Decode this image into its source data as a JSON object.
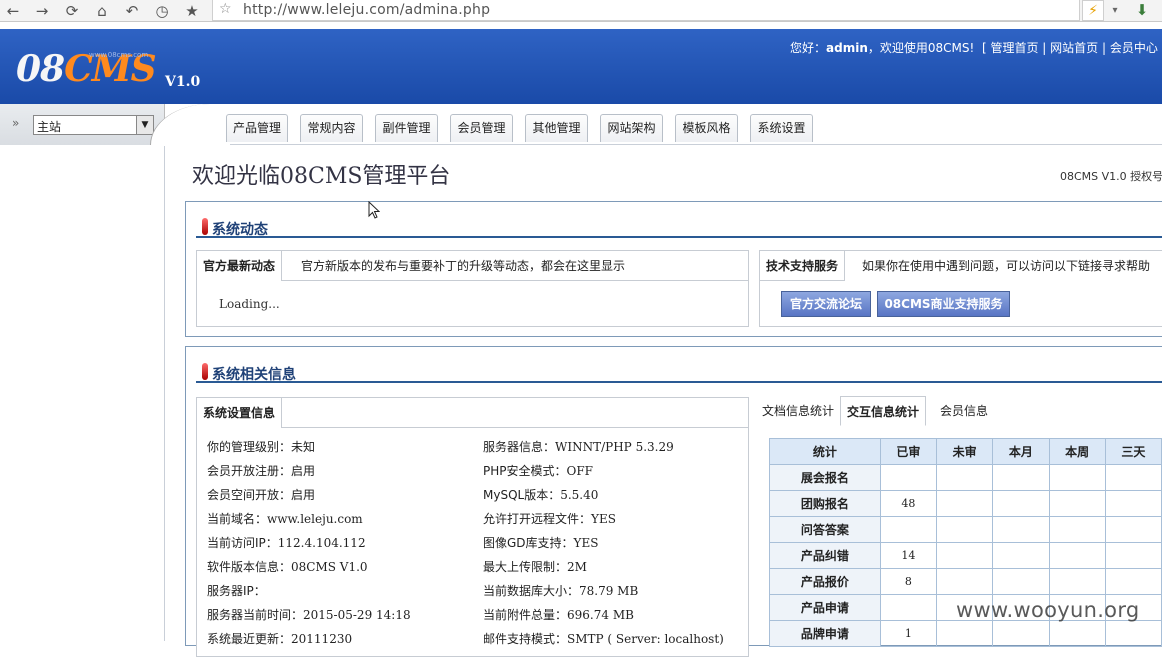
{
  "browser": {
    "url": "http://www.leleju.com/admina.php",
    "back_icon": "←",
    "forward_icon": "→",
    "reload_icon": "⟳",
    "home_icon": "⌂",
    "undo_icon": "↶",
    "history_icon": "◷",
    "bookmark_icon": "★",
    "star_icon": "☆",
    "bolt_icon": "⚡",
    "caret_icon": "▾",
    "ext_icon": "⬇"
  },
  "header": {
    "logo_a": "08",
    "logo_b": "CMS",
    "logo_tag": "www.08cms.com",
    "version": "V1.0",
    "greet_prefix": "您好：",
    "user": "admin",
    "greet_suffix": "，欢迎使用08CMS!",
    "links": "[ 管理首页 | 网站首页 | 会员中心 | 锁"
  },
  "nav": {
    "dbl_icon": "»",
    "site_select": "主站",
    "select_arrow": "▼",
    "tabs": [
      "产品管理",
      "常规内容",
      "副件管理",
      "会员管理",
      "其他管理",
      "网站架构",
      "模板风格",
      "系统设置"
    ]
  },
  "page": {
    "title": "欢迎光临08CMS管理平台",
    "license": "08CMS V1.0 授权号"
  },
  "dynamics": {
    "title": "系统动态",
    "news_tab": "官方最新动态",
    "news_desc": "官方新版本的发布与重要补丁的升级等动态，都会在这里显示",
    "loading": "Loading...",
    "support_tab": "技术支持服务",
    "support_desc": "如果你在使用中遇到问题，可以访问以下链接寻求帮助",
    "btn_forum": "官方交流论坛",
    "btn_service": "08CMS商业支持服务"
  },
  "sysinfo": {
    "title": "系统相关信息",
    "tab": "系统设置信息",
    "left": [
      {
        "k": "你的管理级别：",
        "v": "未知"
      },
      {
        "k": "会员开放注册：",
        "v": "启用"
      },
      {
        "k": "会员空间开放：",
        "v": "启用"
      },
      {
        "k": "当前域名：",
        "v": "www.leleju.com"
      },
      {
        "k": "当前访问IP：",
        "v": "112.4.104.112"
      },
      {
        "k": "软件版本信息：",
        "v": "08CMS V1.0"
      },
      {
        "k": "服务器IP：",
        "v": ""
      },
      {
        "k": "服务器当前时间：",
        "v": "2015-05-29 14:18"
      },
      {
        "k": "系统最近更新：",
        "v": "20111230"
      }
    ],
    "right": [
      {
        "k": "服务器信息：",
        "v": "WINNT/PHP 5.3.29"
      },
      {
        "k": "PHP安全模式：",
        "v": "OFF"
      },
      {
        "k": "MySQL版本：",
        "v": "5.5.40"
      },
      {
        "k": "允许打开远程文件：",
        "v": "YES"
      },
      {
        "k": "图像GD库支持：",
        "v": "YES"
      },
      {
        "k": "最大上传限制：",
        "v": "2M"
      },
      {
        "k": "当前数据库大小：",
        "v": "78.79 MB"
      },
      {
        "k": "当前附件总量：",
        "v": "696.74 MB"
      },
      {
        "k": "邮件支持模式：",
        "v": "SMTP ( Server: localhost)"
      }
    ]
  },
  "stats": {
    "tabs": [
      "文档信息统计",
      "交互信息统计",
      "会员信息"
    ],
    "headers": [
      "统计",
      "已审",
      "未审",
      "本月",
      "本周",
      "三天"
    ],
    "rows": [
      [
        "展会报名",
        "",
        "",
        "",
        "",
        ""
      ],
      [
        "团购报名",
        "48",
        "",
        "",
        "",
        ""
      ],
      [
        "问答答案",
        "",
        "",
        "",
        "",
        ""
      ],
      [
        "产品纠错",
        "14",
        "",
        "",
        "",
        ""
      ],
      [
        "产品报价",
        "8",
        "",
        "",
        "",
        ""
      ],
      [
        "产品申请",
        "",
        "",
        "",
        "",
        ""
      ],
      [
        "品牌申请",
        "1",
        "",
        "",
        "",
        ""
      ]
    ]
  },
  "watermark": "www.wooyun.org"
}
